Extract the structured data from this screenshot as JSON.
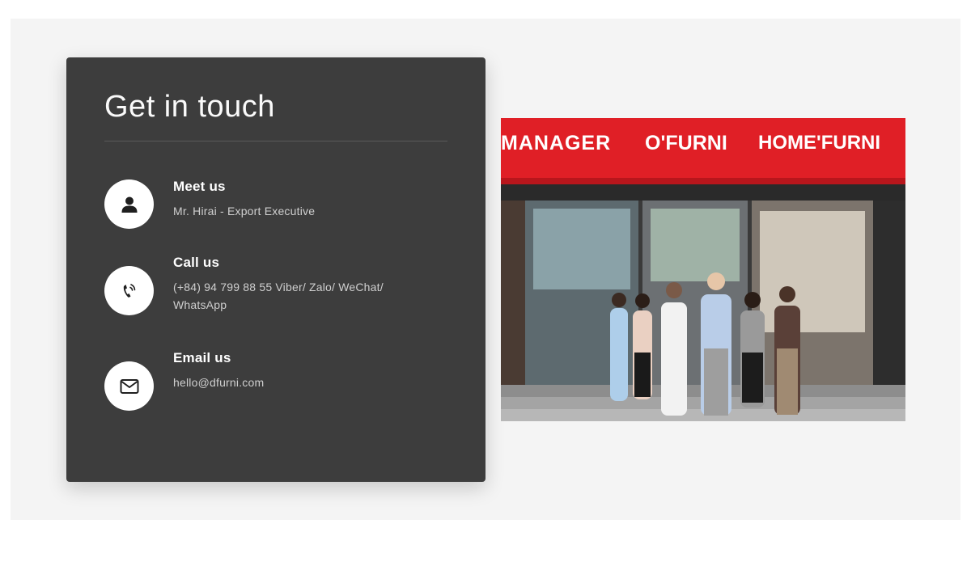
{
  "contact": {
    "title": "Get in touch",
    "items": [
      {
        "icon": "user-icon",
        "label": "Meet us",
        "value": "Mr. Hirai - Export Executive"
      },
      {
        "icon": "phone-icon",
        "label": "Call us",
        "value": "(+84) 94 799 88 55 Viber/ Zalo/ WeChat/ WhatsApp"
      },
      {
        "icon": "envelope-icon",
        "label": "Email us",
        "value": "hello@dfurni.com"
      }
    ]
  },
  "storefront_photo": {
    "signs": [
      "MANAGER",
      "O'FURNI",
      "HOME'FURNI"
    ],
    "sign_color": "#e01f26"
  }
}
